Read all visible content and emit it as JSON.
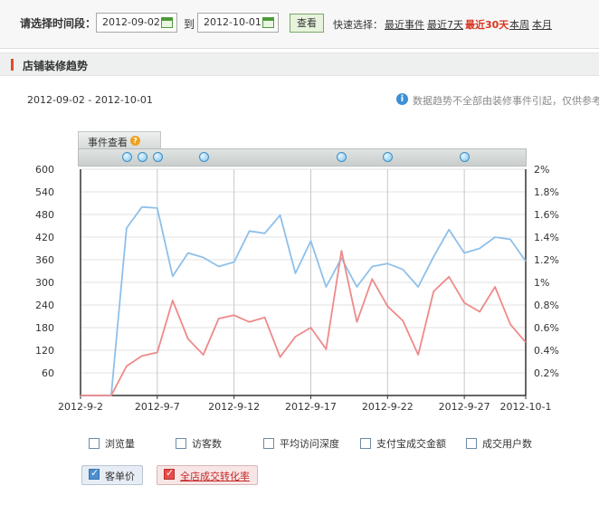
{
  "toolbar": {
    "label": "请选择时间段：",
    "start_date": "2012-09-02",
    "to_label": "到",
    "end_date": "2012-10-01",
    "query_button": "查看",
    "quick_label": "快速选择：",
    "quick_links": [
      {
        "label": "最近事件",
        "active": false
      },
      {
        "label": "最近7天",
        "active": false
      },
      {
        "label": "最近30天",
        "active": true
      },
      {
        "label": "本周",
        "active": false
      },
      {
        "label": "本月",
        "active": false
      }
    ]
  },
  "section": {
    "title": "店铺装修趋势"
  },
  "range_text": "2012-09-02 - 2012-10-01",
  "info": {
    "icon": "info-icon",
    "text": "数据趋势不全部由装修事件引起，仅供参考"
  },
  "events": {
    "tab_label": "事件查看",
    "help_icon": "question-icon",
    "marker_dates": [
      "2012-9-5",
      "2012-9-6",
      "2012-9-7",
      "2012-9-10",
      "2012-9-19",
      "2012-9-22",
      "2012-9-27"
    ]
  },
  "chart_data": {
    "type": "line",
    "x": [
      "2012-9-2",
      "2012-9-3",
      "2012-9-4",
      "2012-9-5",
      "2012-9-6",
      "2012-9-7",
      "2012-9-8",
      "2012-9-9",
      "2012-9-10",
      "2012-9-11",
      "2012-9-12",
      "2012-9-13",
      "2012-9-14",
      "2012-9-15",
      "2012-9-16",
      "2012-9-17",
      "2012-9-18",
      "2012-9-19",
      "2012-9-20",
      "2012-9-21",
      "2012-9-22",
      "2012-9-23",
      "2012-9-24",
      "2012-9-25",
      "2012-9-26",
      "2012-9-27",
      "2012-9-28",
      "2012-9-29",
      "2012-9-30",
      "2012-10-1"
    ],
    "x_tick_labels": [
      "2012-9-2",
      "2012-9-7",
      "2012-9-12",
      "2012-9-17",
      "2012-9-22",
      "2012-9-27",
      "2012-10-1"
    ],
    "x_tick_index": [
      0,
      5,
      10,
      15,
      20,
      25,
      29
    ],
    "y_left": {
      "ylim": [
        0,
        600
      ],
      "ticks": [
        60,
        120,
        180,
        240,
        300,
        360,
        420,
        480,
        540,
        600
      ]
    },
    "y_right": {
      "ylim": [
        0,
        2
      ],
      "ticks": [
        "0.2%",
        "0.4%",
        "0.6%",
        "0.8%",
        "1%",
        "1.2%",
        "1.4%",
        "1.6%",
        "1.8%",
        "2%"
      ]
    },
    "grid": true,
    "series": [
      {
        "name": "客单价",
        "axis": "left",
        "color": "#8ec0ea",
        "values": [
          0,
          0,
          0,
          444,
          500,
          497,
          316,
          378,
          366,
          342,
          354,
          436,
          430,
          478,
          324,
          410,
          288,
          364,
          288,
          342,
          350,
          334,
          288,
          368,
          440,
          378,
          390,
          420,
          414,
          356
        ]
      },
      {
        "name": "全店成交转化率",
        "axis": "right",
        "color": "#ee8a8a",
        "values": [
          0,
          0,
          0,
          0.26,
          0.35,
          0.38,
          0.84,
          0.5,
          0.36,
          0.68,
          0.71,
          0.65,
          0.69,
          0.34,
          0.52,
          0.6,
          0.41,
          1.28,
          0.65,
          1.03,
          0.79,
          0.66,
          0.36,
          0.92,
          1.05,
          0.82,
          0.74,
          0.96,
          0.63,
          0.47
        ]
      }
    ]
  },
  "legend": {
    "options": [
      {
        "label": "浏览量",
        "checked": false
      },
      {
        "label": "访客数",
        "checked": false
      },
      {
        "label": "平均访问深度",
        "checked": false
      },
      {
        "label": "支付宝成交金额",
        "checked": false
      },
      {
        "label": "成交用户数",
        "checked": false
      }
    ],
    "selected": [
      {
        "label": "客单价",
        "checked": true,
        "color": "#4a8fd0"
      },
      {
        "label": "全店成交转化率",
        "checked": true,
        "color": "#e84a4a"
      }
    ]
  }
}
